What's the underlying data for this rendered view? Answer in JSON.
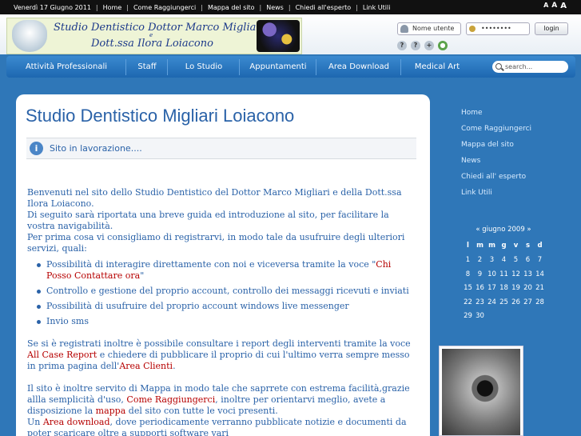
{
  "topbar": {
    "date": "Venerdì 17 Giugno 2011",
    "links": [
      "Home",
      "Come Raggiungerci",
      "Mappa del sito",
      "News",
      "Chiedi all'esperto",
      "Link Utili"
    ],
    "font_sizes": [
      "A",
      "A",
      "A"
    ]
  },
  "header": {
    "logo_line1": "Studio Dentistico Dottor Marco Migliari",
    "logo_e": "e",
    "logo_line2": "Dott.ssa Ilora Loiacono",
    "username_placeholder": "Nome utente",
    "password_value": "••••••••",
    "login_label": "login"
  },
  "nav": {
    "items": [
      "Attività Professionali",
      "Staff",
      "Lo Studio",
      "Appuntamenti",
      "Area Download",
      "Medical Art"
    ],
    "search_placeholder": "search..."
  },
  "main": {
    "title": "Studio Dentistico Migliari Loiacono",
    "notice": "Sito in lavorazione....",
    "p1": "Benvenuti nel sito dello Studio Dentistico del Dottor Marco Migliari e della Dott.ssa Ilora Loiacono.",
    "p2": "Di seguito sarà riportata una breve guida ed introduzione al sito, per facilitare la vostra navigabilità.",
    "p3": "Per prima cosa vi consigliamo di registrarvi, in modo tale da usufruire degli ulteriori servizi, quali:",
    "bullet1_a": "Possibilità di interagire direttamente con noi e viceversa tramite la voce \"",
    "bullet1_link": "Chi Posso Contattare ora",
    "bullet1_b": "\"",
    "bullet2": "Controllo e gestione del proprio account, controllo dei messaggi ricevuti e inviati",
    "bullet3": "Possibilità di usufruire del proprio account windows live messenger",
    "bullet4": "Invio sms",
    "p4_a": "Se si è registrati inoltre è possibile consultare i report degli interventi tramite la voce ",
    "p4_link": "All Case Report",
    "p4_b": " e chiedere di pubblicare il proprio di cui l'ultimo verra sempre messo in prima pagina dell'",
    "p4_link2": "Area Clienti",
    "p4_c": ".",
    "p5_a": "Il sito è inoltre servito di Mappa in modo tale che saprrete con estrema facilità,grazie allla semplicità d'uso, ",
    "p5_link": "Come Raggiungerci",
    "p5_b": ", inoltre per orientarvi meglio, avete a disposizione la ",
    "p5_link2": "mappa",
    "p5_c": " del sito con tutte le voci presenti.",
    "p6_a": "Un ",
    "p6_link": "Area download",
    "p6_b": ", dove periodicamente verranno pubblicate notizie e documenti da poter scaricare oltre a supporti software vari"
  },
  "rightmenu": {
    "items": [
      "Home",
      "Come Raggiungerci",
      "Mappa del sito",
      "News",
      "Chiedi all' esperto",
      "Link Utili"
    ]
  },
  "calendar": {
    "header": "« giugno 2009 »",
    "days": [
      "l",
      "m",
      "m",
      "g",
      "v",
      "s",
      "d"
    ],
    "rows": [
      [
        "1",
        "2",
        "3",
        "4",
        "5",
        "6",
        "7"
      ],
      [
        "8",
        "9",
        "10",
        "11",
        "12",
        "13",
        "14"
      ],
      [
        "15",
        "16",
        "17",
        "18",
        "19",
        "20",
        "21"
      ],
      [
        "22",
        "23",
        "24",
        "25",
        "26",
        "27",
        "28"
      ],
      [
        "29",
        "30",
        "",
        "",
        "",
        "",
        ""
      ]
    ]
  }
}
